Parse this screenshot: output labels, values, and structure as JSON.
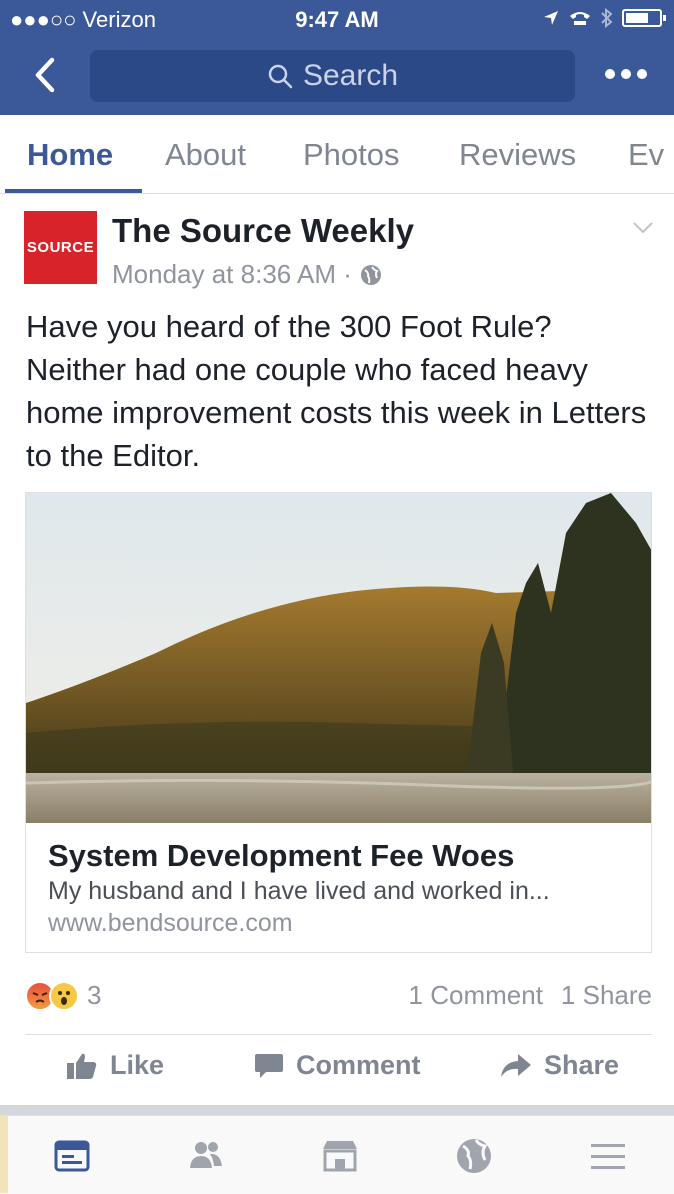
{
  "status_bar": {
    "carrier": "●●●○○ Verizon",
    "time": "9:47 AM"
  },
  "nav": {
    "search_placeholder": "Search"
  },
  "tabs": [
    {
      "label": "Home",
      "active": true
    },
    {
      "label": "About"
    },
    {
      "label": "Photos"
    },
    {
      "label": "Reviews"
    },
    {
      "label": "Ev"
    }
  ],
  "post": {
    "logo_text": "SOURCE",
    "author": "The Source Weekly",
    "timestamp": "Monday at 8:36 AM ·",
    "text": "Have you heard of the 300 Foot Rule? Neither had one couple who faced heavy home improvement costs this week in Letters to the Editor.",
    "link": {
      "title": "System Development Fee Woes",
      "description": "My husband and I have lived and worked in...",
      "url": "www.bendsource.com"
    },
    "reaction_count": "3",
    "comments": "1 Comment",
    "shares": "1 Share"
  },
  "actions": {
    "like": "Like",
    "comment": "Comment",
    "share": "Share"
  },
  "colors": {
    "brand": "#3b5998",
    "logo_red": "#d9232b"
  },
  "icons": {
    "tabbar": [
      "news-feed-icon",
      "friends-icon",
      "marketplace-icon",
      "globe-icon",
      "menu-icon"
    ]
  }
}
